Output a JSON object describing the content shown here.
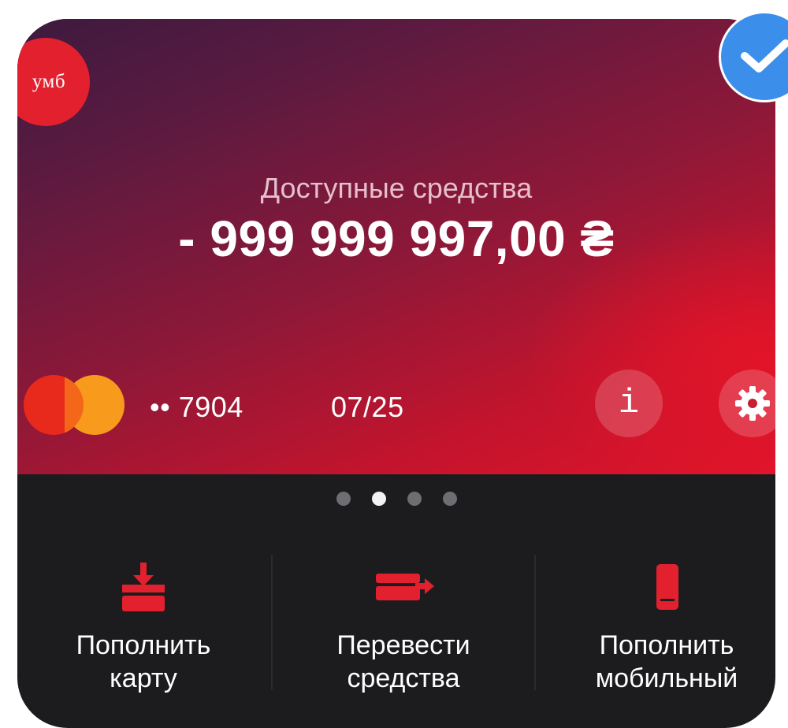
{
  "card": {
    "bank_logo_text": "умб",
    "balance_label": "Доступные средства",
    "balance_amount": "- 999 999 997,00 ₴",
    "card_number": "•• 7904",
    "expiry": "07/25",
    "info_button_glyph": "i",
    "payment_system_icon": "mastercard-logo",
    "settings_icon": "gear-icon"
  },
  "pager": {
    "total": 4,
    "active_index": 1
  },
  "actions": [
    {
      "label": "Пополнить\nкарту",
      "icon": "card-top-up-icon"
    },
    {
      "label": "Перевести\nсредства",
      "icon": "card-transfer-icon"
    },
    {
      "label": "Пополнить\nмобильный",
      "icon": "mobile-top-up-icon"
    }
  ],
  "colors": {
    "accent_red": "#e3202e",
    "panel_dark": "#1c1c1f",
    "verified_blue": "#3b8eea"
  }
}
